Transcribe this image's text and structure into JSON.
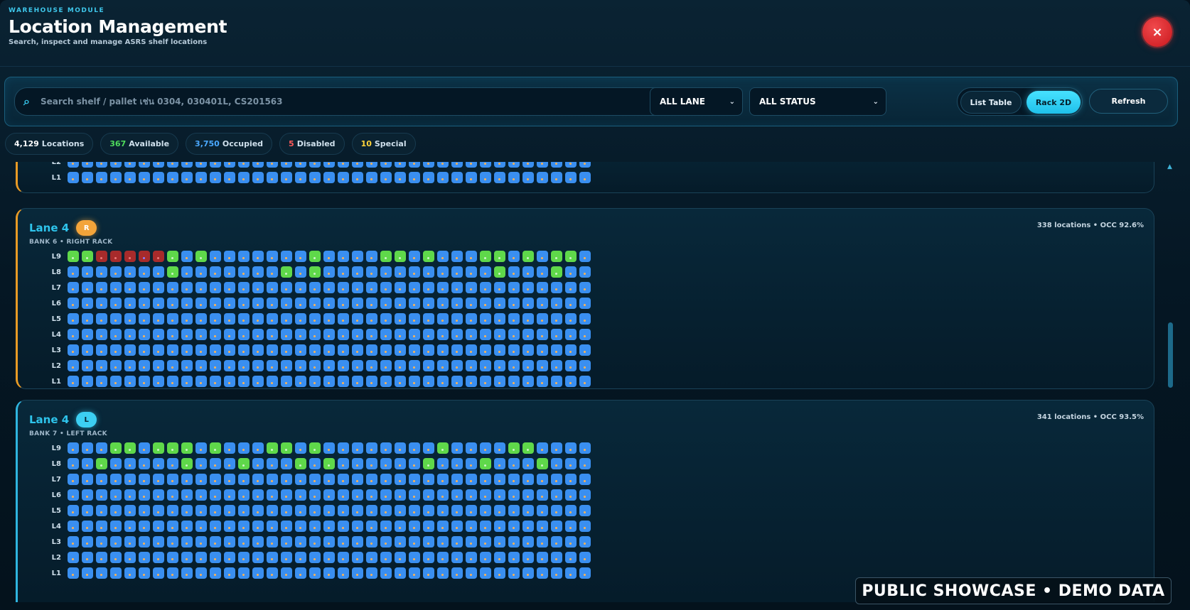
{
  "header": {
    "module_tag": "WAREHOUSE MODULE",
    "title": "Location Management",
    "subtitle": "Search, inspect and manage ASRS shelf locations",
    "close_glyph": "×"
  },
  "toolbar": {
    "search_icon": "⌕",
    "search_placeholder": "Search shelf / pallet เช่น 0304, 030401L, CS201563",
    "search_value": "",
    "lane_filter": "ALL LANE",
    "status_filter": "ALL STATUS",
    "view_list_label": "List Table",
    "view_rack_label": "Rack 2D",
    "active_view": "Rack 2D",
    "refresh_label": "Refresh"
  },
  "stats": [
    {
      "num": "4,129",
      "label": "Locations",
      "color": "#ffffff"
    },
    {
      "num": "367",
      "label": "Available",
      "color": "#4fdc5c"
    },
    {
      "num": "3,750",
      "label": "Occupied",
      "color": "#4aa9ff"
    },
    {
      "num": "5",
      "label": "Disabled",
      "color": "#ff5a5a"
    },
    {
      "num": "10",
      "label": "Special",
      "color": "#ffd43b"
    }
  ],
  "status_colors": {
    "occupied": "#3a8ff0",
    "available": "#5fd84a",
    "disabled": "#a72b2b"
  },
  "lanes": [
    {
      "title": "",
      "badge": "",
      "bank": "",
      "meta": "",
      "partial": true,
      "rows": [
        {
          "label": "L2",
          "cells": "ooooooooooooooooooooooooooooooooooooo"
        },
        {
          "label": "L1",
          "cells": "ooooooooooooooooooooooooooooooooooooo"
        }
      ]
    },
    {
      "title": "Lane 4",
      "badge": "R",
      "bank": "BANK 6 • RIGHT RACK",
      "meta": "338 locations • OCC 92.6%",
      "rows": [
        {
          "label": "L9",
          "cells": "aadddsdaoaoooooooaooooaaoaoooaaoaoaao"
        },
        {
          "label": "L8",
          "cells": "oooooooaoooooooaoaooooooooooooaoooaoo"
        },
        {
          "label": "L7",
          "cells": "ooooooooooooooooooooooooooooooooooooo"
        },
        {
          "label": "L6",
          "cells": "ooooooooooooooooooooooooooooooooooooo"
        },
        {
          "label": "L5",
          "cells": "ooooooooooooooooooooooooooooooooooooo"
        },
        {
          "label": "L4",
          "cells": "ooooooooooooooooooooooooooooooooooooo"
        },
        {
          "label": "L3",
          "cells": "ooooooooooooooooooooooooooooooooooooo"
        },
        {
          "label": "L2",
          "cells": "ooooooooooooooooooooooooooooooooooooo"
        },
        {
          "label": "L1",
          "cells": "ooooooooooooooooooooooooooooooooooooo"
        }
      ]
    },
    {
      "title": "Lane 4",
      "badge": "L",
      "bank": "BANK 7 • LEFT RACK",
      "meta": "341 locations • OCC 93.5%",
      "rows": [
        {
          "label": "L9",
          "cells": "oooaaoaaaoaoooaaoaooooooooaooooaaooooaoao"
        },
        {
          "label": "L8",
          "cells": "ooaoooooaoooaoooaoaooooooaoooaoooaooooa"
        },
        {
          "label": "L7",
          "cells": "ooooooooooooooooooooooooooooooooooooo"
        },
        {
          "label": "L6",
          "cells": "ooooooooooooooooooooooooooooooooooooo"
        },
        {
          "label": "L5",
          "cells": "ooooooooooooooooooooooooooooooooooooo"
        },
        {
          "label": "L4",
          "cells": "ooooooooooooooooooooooooooooooooooooo"
        },
        {
          "label": "L3",
          "cells": "ooooooooooooooooooooooooooooooooooooo"
        },
        {
          "label": "L2",
          "cells": "ooooooooooooooooooooooooooooooooooooo"
        },
        {
          "label": "L1",
          "cells": "ooooooooooooooooooooooooooooooooooooo"
        }
      ]
    }
  ],
  "watermark": "PUBLIC SHOWCASE • DEMO DATA"
}
